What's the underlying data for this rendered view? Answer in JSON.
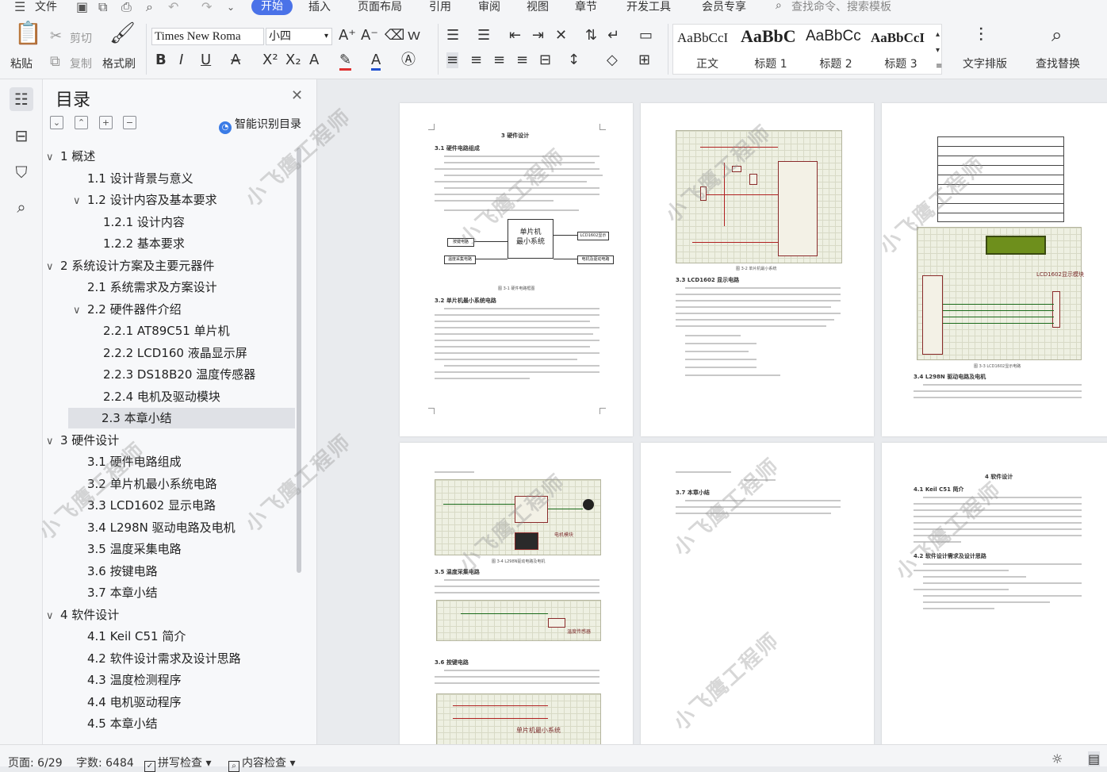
{
  "menubar": {
    "file": "文件",
    "tabs": [
      "开始",
      "插入",
      "页面布局",
      "引用",
      "审阅",
      "视图",
      "章节",
      "开发工具",
      "会员专享"
    ],
    "active_tab": "开始",
    "search_placeholder": "查找命令、搜索模板"
  },
  "ribbon": {
    "paste": "粘贴",
    "cut": "剪切",
    "copy": "复制",
    "format_painter": "格式刷",
    "font_name": "Times New Roma",
    "font_size": "小四",
    "styles": [
      {
        "sample": "AaBbCcI",
        "name": "正文"
      },
      {
        "sample": "AaBbC",
        "name": "标题 1"
      },
      {
        "sample": "AaBbCc",
        "name": "标题 2"
      },
      {
        "sample": "AaBbCcI",
        "name": "标题 3"
      }
    ],
    "text_layout": "文字排版",
    "find_replace": "查找替换"
  },
  "toc": {
    "title": "目录",
    "smart_button": "智能识别目录",
    "items": [
      {
        "label": "1  概述",
        "level": 1,
        "expand": true
      },
      {
        "label": "1.1  设计背景与意义",
        "level": 2
      },
      {
        "label": "1.2  设计内容及基本要求",
        "level": 2,
        "expand": true
      },
      {
        "label": "1.2.1  设计内容",
        "level": 3
      },
      {
        "label": "1.2.2  基本要求",
        "level": 3
      },
      {
        "label": "2  系统设计方案及主要元器件",
        "level": 1,
        "expand": true
      },
      {
        "label": "2.1  系统需求及方案设计",
        "level": 2
      },
      {
        "label": "2.2  硬件器件介绍",
        "level": 2,
        "expand": true
      },
      {
        "label": "2.2.1 AT89C51 单片机",
        "level": 3
      },
      {
        "label": "2.2.2 LCD160 液晶显示屏",
        "level": 3
      },
      {
        "label": "2.2.3 DS18B20 温度传感器",
        "level": 3
      },
      {
        "label": "2.2.4  电机及驱动模块",
        "level": 3
      },
      {
        "label": "2.3 本章小结",
        "level": 2,
        "selected": true
      },
      {
        "label": "3  硬件设计",
        "level": 1,
        "expand": true
      },
      {
        "label": "3.1  硬件电路组成",
        "level": 2
      },
      {
        "label": "3.2  单片机最小系统电路",
        "level": 2
      },
      {
        "label": "3.3 LCD1602 显示电路",
        "level": 2
      },
      {
        "label": "3.4 L298N 驱动电路及电机",
        "level": 2
      },
      {
        "label": "3.5  温度采集电路",
        "level": 2
      },
      {
        "label": "3.6  按键电路",
        "level": 2
      },
      {
        "label": "3.7  本章小结",
        "level": 2
      },
      {
        "label": "4  软件设计",
        "level": 1,
        "expand": true
      },
      {
        "label": "4.1 Keil C51 简介",
        "level": 2
      },
      {
        "label": "4.2  软件设计需求及设计思路",
        "level": 2
      },
      {
        "label": "4.3 温度检测程序",
        "level": 2
      },
      {
        "label": "4.4  电机驱动程序",
        "level": 2
      },
      {
        "label": "4.5  本章小结",
        "level": 2
      }
    ]
  },
  "pages": {
    "p1": {
      "title": "3  硬件设计",
      "h1": "3.1 硬件电路组成",
      "mcu_block": "单片机\n最小系统",
      "blk_key": "按键电路",
      "blk_temp": "温度采集电路",
      "blk_lcd": "LCD1602显示",
      "blk_motor": "电机及驱动电路",
      "fig": "图 3-1  硬件电路框图",
      "h2": "3.2 单片机最小系统电路"
    },
    "p2": {
      "h1": "3.3 LCD1602 显示电路",
      "fig": "图 3-2 单片机最小系统"
    },
    "p3": {
      "fig": "图 3-3 LCD1602显示电路",
      "h1": "3.4 L298N 驱动电路及电机",
      "lcd_label": "LCD1602显示模块"
    },
    "p4": {
      "fig": "图 3-4 L298N驱动电路及电机",
      "h1": "3.5 温度采集电路",
      "h2": "3.6 按键电路",
      "circ1": "电机模块",
      "circ2": "温度传感器",
      "circ3": "单片机最小系统"
    },
    "p5": {
      "h1": "3.7 本章小结"
    },
    "p6": {
      "title": "4  软件设计",
      "h1": "4.1 Keil C51 简介",
      "h2": "4.2 软件设计需求及设计思路"
    }
  },
  "watermark": "小飞鹰工程师",
  "statusbar": {
    "page": "页面: 6/29",
    "words": "字数: 6484",
    "spell": "拼写检查",
    "content_check": "内容检查"
  }
}
